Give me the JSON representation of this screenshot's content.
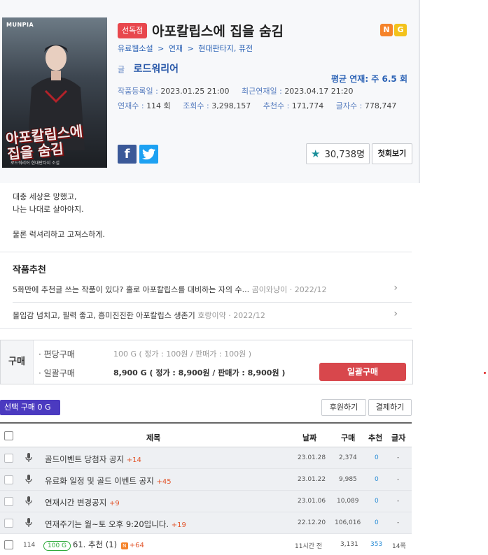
{
  "work": {
    "exclusive_tag": "선독점",
    "title": "아포칼립스에 집을 숨김",
    "badges": [
      "N",
      "G"
    ],
    "breadcrumb": [
      "유료웹소설",
      ">",
      "연재",
      ">",
      "현대판타지, 퓨전"
    ],
    "author_label": "글",
    "author": "로드워리어",
    "avg_serial": "평균 연재: 주 6.5 회",
    "meta_row1": [
      {
        "k": "작품등록일 :",
        "v": "2023.01.25 21:00"
      },
      {
        "k": "최근연재일 :",
        "v": "2023.04.17 21:20"
      }
    ],
    "meta_row2": [
      {
        "k": "연재수 :",
        "v": "114 회"
      },
      {
        "k": "조회수 :",
        "v": "3,298,157"
      },
      {
        "k": "추천수 :",
        "v": "171,774"
      },
      {
        "k": "글자수 :",
        "v": "778,747"
      }
    ],
    "favorites": "30,738명",
    "first_view": "첫회보기",
    "cover": {
      "logo": "MUNPIA",
      "title_line1": "아포칼립스에",
      "title_line2": "집을 숨김",
      "sub": "로드워리어 현대판타지 소설"
    }
  },
  "description": [
    "대충 세상은 망했고,",
    "나는 나대로 살아야지.",
    "",
    "물론 럭셔리하고 고져스하게."
  ],
  "recommendations": {
    "title": "작품추천",
    "items": [
      {
        "text": "5화만에 추천글 쓰는 작품이 있다? 홀로 아포칼립스를 대비하는 자의 수...",
        "by": "곰이와냥이 · 2022/12"
      },
      {
        "text": "몰입감 넘치고, 필력 좋고, 흥미진진한 아포칼립스 생존기",
        "by": "호랑이약 · 2022/12"
      }
    ]
  },
  "purchase": {
    "label": "구매",
    "per_episode_label": "· 편당구매",
    "per_episode_price": "100 G ( 정가 : 100원 / 판매가 : 100원 )",
    "bulk_label": "· 일괄구매",
    "bulk_price": "8,900 G ( 정가 : 8,900원 / 판매가 : 8,900원 )",
    "bulk_button": "일괄구매"
  },
  "toolbar": {
    "select_buy": "선택 구매 0 G",
    "support": "후원하기",
    "pay": "결제하기"
  },
  "table": {
    "headers": {
      "title": "제목",
      "date": "날짜",
      "buy": "구매",
      "rec": "추천",
      "chars": "글자"
    },
    "notices": [
      {
        "title": "골드이벤트 당첨자 공지",
        "plus": "+14",
        "date": "23.01.28",
        "buy": "2,374",
        "rec": "0",
        "chars": "-"
      },
      {
        "title": "유료화 일정 및 골드 이벤트 공지",
        "plus": "+45",
        "date": "23.01.22",
        "buy": "9,985",
        "rec": "0",
        "chars": "-"
      },
      {
        "title": "연재시간 변경공지",
        "plus": "+9",
        "date": "23.01.06",
        "buy": "10,089",
        "rec": "0",
        "chars": "-"
      },
      {
        "title": "연재주기는 월~토 오후 9:20입니다.",
        "plus": "+19",
        "date": "22.12.20",
        "buy": "106,016",
        "rec": "0",
        "chars": "-"
      }
    ],
    "episode": {
      "no": "114",
      "price": "100 G",
      "title": "61. 추천 (1)",
      "new_icon": "N",
      "plus": "+64",
      "date": "11시간 전",
      "buy": "3,131",
      "rec": "353",
      "chars": "14쪽"
    }
  }
}
